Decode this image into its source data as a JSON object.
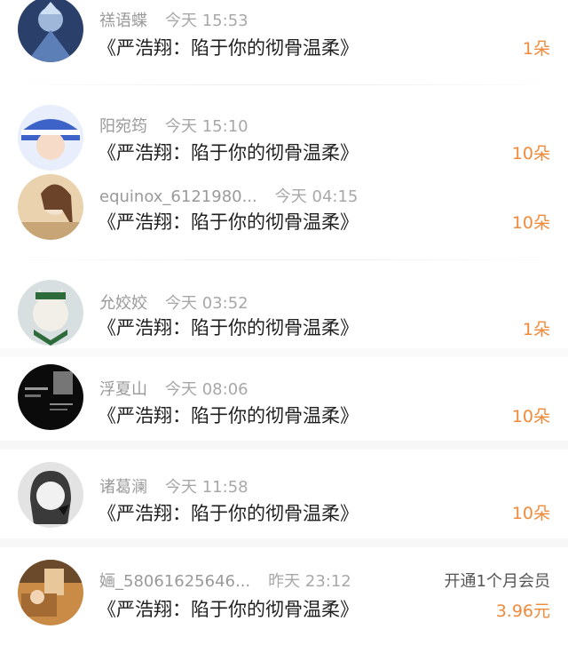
{
  "gift_records": [
    {
      "name": "禚语蝶",
      "time": "今天 15:53",
      "title": "《严浩翔：陷于你的彻骨温柔》",
      "amount": "1朵",
      "avatar_icon": "knight-avatar-icon"
    },
    {
      "name": "阳宛筠",
      "time": "今天 15:10",
      "title": "《严浩翔：陷于你的彻骨温柔》",
      "amount": "10朵",
      "avatar_icon": "kid-avatar-icon"
    },
    {
      "name": "equinox_6121980...",
      "time": "今天 04:15",
      "title": "《严浩翔：陷于你的彻骨温柔》",
      "amount": "10朵",
      "avatar_icon": "girl-avatar-icon"
    },
    {
      "name": "允姣姣",
      "time": "今天 03:52",
      "title": "《严浩翔：陷于你的彻骨温柔》",
      "amount": "1朵",
      "avatar_icon": "cat-avatar-icon"
    },
    {
      "name": "浮夏山",
      "time": "今天 08:06",
      "title": "《严浩翔：陷于你的彻骨温柔》",
      "amount": "10朵",
      "avatar_icon": "dark-poster-avatar-icon"
    },
    {
      "name": "诸葛澜",
      "time": "今天 11:58",
      "title": "《严浩翔：陷于你的彻骨温柔》",
      "amount": "10朵",
      "avatar_icon": "grey-girl-avatar-icon"
    },
    {
      "name": "婳_58061625646...",
      "time": "昨天 23:12",
      "title": "《严浩翔：陷于你的彻骨温柔》",
      "amount": "3.96元",
      "membership_label": "开通1个月会员",
      "avatar_icon": "room-avatar-icon"
    }
  ],
  "colors": {
    "amount": "#f08a3a",
    "name": "#9a9a9a",
    "title": "#1f1f1f"
  }
}
